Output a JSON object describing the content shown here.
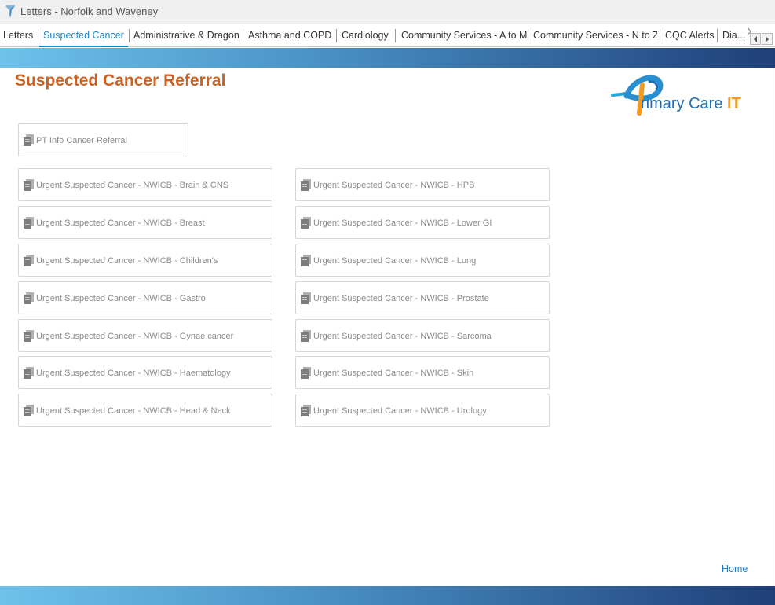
{
  "window": {
    "title": "Letters - Norfolk and Waveney",
    "icon": "funnel-logo-icon"
  },
  "tabs": [
    {
      "label": "Letters",
      "active": false
    },
    {
      "label": "Suspected Cancer",
      "active": true
    },
    {
      "label": "Administrative & Dragon",
      "active": false
    },
    {
      "label": "Asthma and COPD",
      "active": false
    },
    {
      "label": "Cardiology",
      "active": false
    },
    {
      "label": "Community Services - A to M",
      "active": false
    },
    {
      "label": "Community Services - N to Z",
      "active": false
    },
    {
      "label": "CQC Alerts",
      "active": false
    },
    {
      "label": "Dia...",
      "active": false
    }
  ],
  "tab_scroll": {
    "left_icon": "chevron-left-icon",
    "right_icon": "chevron-right-icon"
  },
  "page": {
    "title": "Suspected Cancer Referral"
  },
  "logo": {
    "text_main": "rimary Care ",
    "text_accent": "IT",
    "icon": "ribbon-p-logo-icon"
  },
  "pt_info": {
    "label": "PT Info Cancer Referral",
    "icon": "document-icon"
  },
  "left_column": [
    {
      "label": "Urgent Suspected Cancer - NWICB - Brain & CNS"
    },
    {
      "label": "Urgent Suspected Cancer - NWICB - Breast"
    },
    {
      "label": "Urgent Suspected Cancer - NWICB - Children's"
    },
    {
      "label": "Urgent Suspected Cancer - NWICB - Gastro"
    },
    {
      "label": "Urgent Suspected Cancer - NWICB - Gynae cancer"
    },
    {
      "label": "Urgent Suspected Cancer - NWICB - Haematology"
    },
    {
      "label": "Urgent Suspected Cancer - NWICB - Head & Neck"
    }
  ],
  "right_column": [
    {
      "label": "Urgent Suspected Cancer - NWICB - HPB"
    },
    {
      "label": "Urgent Suspected Cancer - NWICB - Lower GI"
    },
    {
      "label": "Urgent Suspected Cancer - NWICB - Lung"
    },
    {
      "label": "Urgent Suspected Cancer - NWICB - Prostate"
    },
    {
      "label": "Urgent Suspected Cancer - NWICB - Sarcoma"
    },
    {
      "label": "Urgent Suspected Cancer - NWICB - Skin"
    },
    {
      "label": "Urgent Suspected Cancer - NWICB - Urology"
    }
  ],
  "footer": {
    "home_label": "Home"
  },
  "colors": {
    "title_orange": "#cd6220",
    "active_tab_blue": "#1d86c8",
    "link_blue": "#1d7cc4",
    "banner_start": "#6dc2ea",
    "banner_end": "#1f3f78",
    "logo_blue": "#1e6eb4",
    "logo_orange": "#f39a1e"
  }
}
